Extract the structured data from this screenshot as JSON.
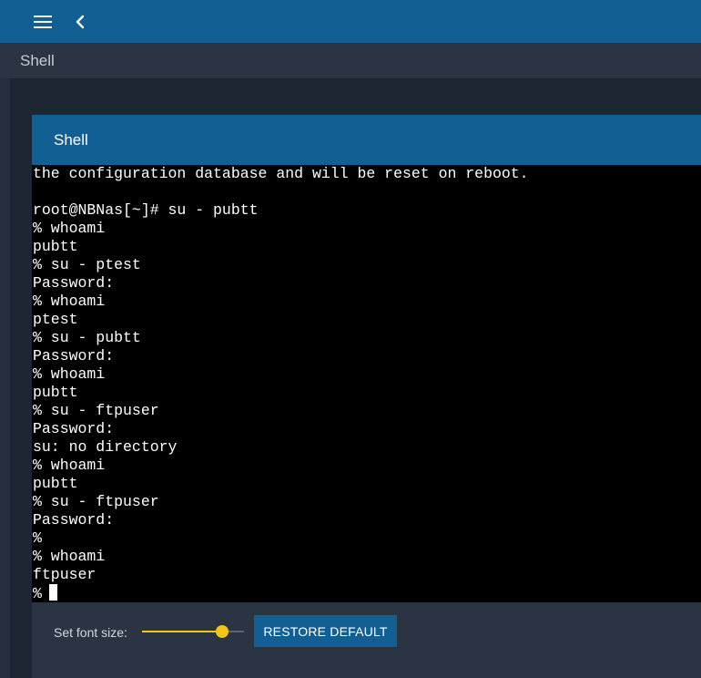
{
  "topbar": {
    "menu_icon": "hamburger-menu-icon",
    "back_icon": "chevron-left-icon"
  },
  "breadcrumb": {
    "title": "Shell"
  },
  "card": {
    "title": "Shell"
  },
  "terminal": {
    "lines": [
      "the configuration database and will be reset on reboot.",
      "",
      "root@NBNas[~]# su - pubtt",
      "% whoami",
      "pubtt",
      "% su - ptest",
      "Password:",
      "% whoami",
      "ptest",
      "% su - pubtt",
      "Password:",
      "% whoami",
      "pubtt",
      "% su - ftpuser",
      "Password:",
      "su: no directory",
      "% whoami",
      "pubtt",
      "% su - ftpuser",
      "Password:",
      "%",
      "% whoami",
      "ftpuser",
      "%"
    ]
  },
  "controls": {
    "font_size_label": "Set font size:",
    "font_size_slider_fraction": 0.79,
    "restore_label": "RESTORE DEFAULT"
  },
  "colors": {
    "primary": "#125f94",
    "background": "#1e2633",
    "accent": "#f3c515"
  }
}
